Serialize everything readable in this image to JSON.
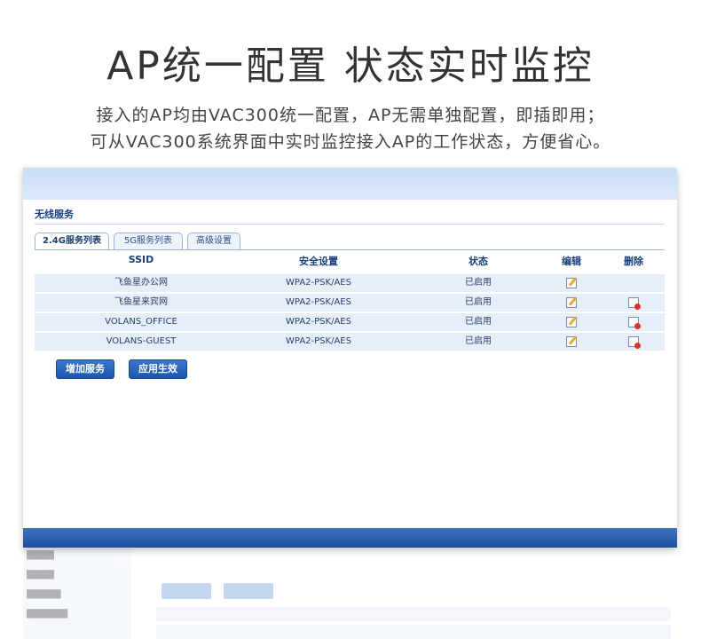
{
  "headline": "AP统一配置  状态实时监控",
  "subline1": "接入的AP均由VAC300统一配置，AP无需单独配置，即插即用；",
  "subline2": "可从VAC300系统界面中实时监控接入AP的工作状态，方便省心。",
  "panel": {
    "section_title": "无线服务",
    "tabs": [
      {
        "label": "2.4G服务列表",
        "active": true
      },
      {
        "label": "5G服务列表",
        "active": false
      },
      {
        "label": "高级设置",
        "active": false
      }
    ],
    "columns": {
      "ssid": "SSID",
      "security": "安全设置",
      "state": "状态",
      "edit": "编辑",
      "delete": "删除"
    },
    "rows": [
      {
        "ssid": "飞鱼星办公网",
        "security": "WPA2-PSK/AES",
        "state": "已启用",
        "deletable": false
      },
      {
        "ssid": "飞鱼星来宾网",
        "security": "WPA2-PSK/AES",
        "state": "已启用",
        "deletable": true
      },
      {
        "ssid": "VOLANS_OFFICE",
        "security": "WPA2-PSK/AES",
        "state": "已启用",
        "deletable": true
      },
      {
        "ssid": "VOLANS-GUEST",
        "security": "WPA2-PSK/AES",
        "state": "已启用",
        "deletable": true
      }
    ],
    "buttons": {
      "add": "增加服务",
      "apply": "应用生效"
    }
  },
  "icons": {
    "edit": "edit-icon",
    "delete": "delete-icon"
  },
  "colors": {
    "accent": "#1c56a8",
    "row_bg": "#e6eefa",
    "header_text": "#1a3e7a"
  }
}
